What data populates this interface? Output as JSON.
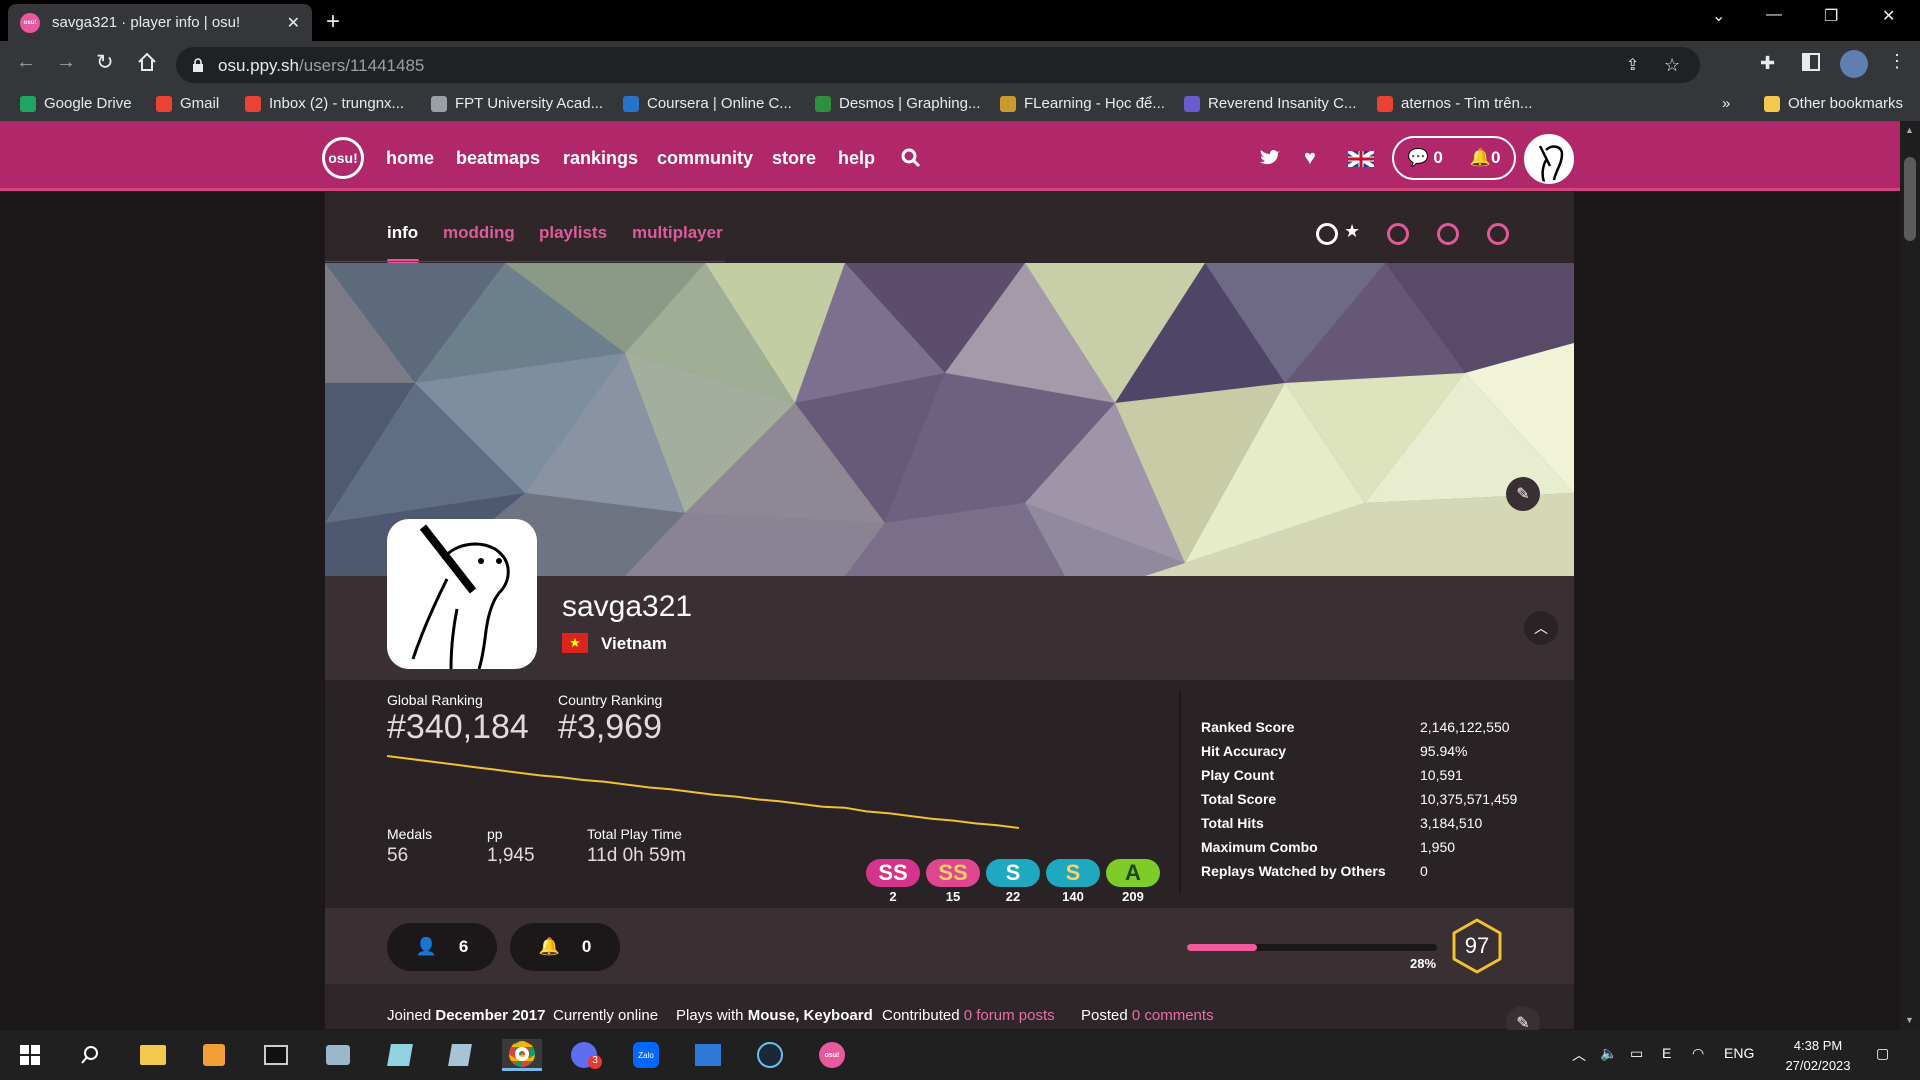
{
  "browser": {
    "tab_title": "savga321 · player info | osu!",
    "url_host": "osu.ppy.sh",
    "url_path": "/users/11441485",
    "bookmarks": [
      {
        "label": "Google Drive",
        "color": "#1fa463"
      },
      {
        "label": "Gmail",
        "color": "#ea4335"
      },
      {
        "label": "Inbox (2) - trungnx...",
        "color": "#ea4335"
      },
      {
        "label": "FPT University Acad...",
        "color": "#9aa0a6"
      },
      {
        "label": "Coursera | Online C...",
        "color": "#2a73cc"
      },
      {
        "label": "Desmos | Graphing...",
        "color": "#2f8f3a"
      },
      {
        "label": "FLearning - Học để...",
        "color": "#c99a2e"
      },
      {
        "label": "Reverend Insanity C...",
        "color": "#6a5acd"
      },
      {
        "label": "aternos - Tìm trên...",
        "color": "#ea4335"
      }
    ],
    "more_bookmarks": "»",
    "other_bookmarks": "Other bookmarks"
  },
  "osu_nav": {
    "logo": "osu!",
    "links": [
      "home",
      "beatmaps",
      "rankings",
      "community",
      "store",
      "help"
    ],
    "chat_count": "0",
    "notif_count": "0",
    "accent": "#b1286a"
  },
  "profile_tabs": [
    "info",
    "modding",
    "playlists",
    "multiplayer"
  ],
  "profile": {
    "username": "savga321",
    "country": "Vietnam",
    "global_ranking_label": "Global Ranking",
    "global_ranking": "#340,184",
    "country_ranking_label": "Country Ranking",
    "country_ranking": "#3,969",
    "medals_label": "Medals",
    "medals": "56",
    "pp_label": "pp",
    "pp": "1,945",
    "playtime_label": "Total Play Time",
    "playtime": "11d 0h 59m",
    "grades": [
      {
        "label": "SS",
        "count": "2",
        "color": "#d6338c",
        "text": "#ffffff"
      },
      {
        "label": "SS",
        "count": "15",
        "color": "#e0468f",
        "text": "#ffd166"
      },
      {
        "label": "S",
        "count": "22",
        "color": "#1fa9c0",
        "text": "#ffffff"
      },
      {
        "label": "S",
        "count": "140",
        "color": "#1fa9c0",
        "text": "#ffd166"
      },
      {
        "label": "A",
        "count": "209",
        "color": "#7ecb2a",
        "text": "#1c4a05"
      }
    ],
    "stats": [
      {
        "label": "Ranked Score",
        "value": "2,146,122,550"
      },
      {
        "label": "Hit Accuracy",
        "value": "95.94%"
      },
      {
        "label": "Play Count",
        "value": "10,591"
      },
      {
        "label": "Total Score",
        "value": "10,375,571,459"
      },
      {
        "label": "Total Hits",
        "value": "3,184,510"
      },
      {
        "label": "Maximum Combo",
        "value": "1,950"
      },
      {
        "label": "Replays Watched by Others",
        "value": "0"
      }
    ],
    "followers": "6",
    "subscribers": "0",
    "level_progress_label": "28%",
    "level_progress": 0.28,
    "level": "97",
    "info_joined_prefix": "Joined",
    "info_joined": "December 2017",
    "info_online": "Currently online",
    "info_plays_prefix": "Plays with",
    "info_plays": "Mouse, Keyboard",
    "info_contrib_prefix": "Contributed",
    "info_contrib": "0 forum posts",
    "info_posted_prefix": "Posted",
    "info_posted": "0 comments"
  },
  "rank_history": [
    100,
    97,
    94,
    91,
    88,
    85,
    82,
    79,
    77,
    74,
    72,
    69,
    66,
    64,
    61,
    58,
    56,
    53,
    51,
    48,
    45,
    44,
    40,
    38,
    35,
    32,
    30,
    27,
    25,
    22
  ],
  "taskbar": {
    "language": "ENG",
    "time": "4:38 PM",
    "date": "27/02/2023",
    "badge": "3"
  }
}
